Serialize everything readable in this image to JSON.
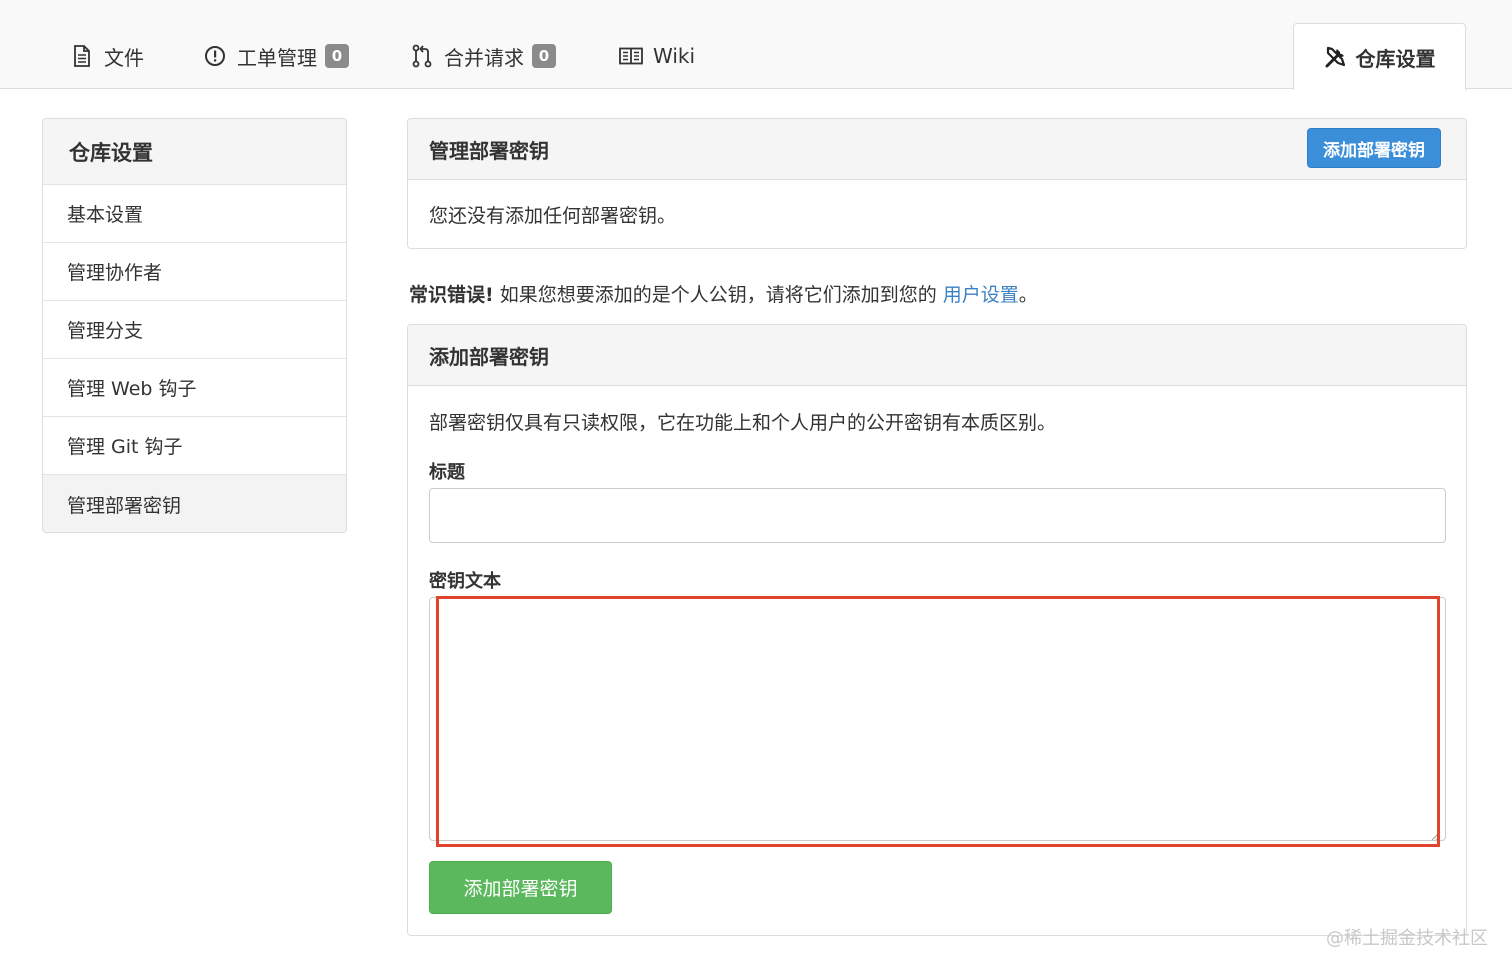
{
  "tabs": {
    "files": {
      "label": "文件",
      "icon": "file-icon"
    },
    "issues": {
      "label": "工单管理",
      "count": "0",
      "icon": "issue-icon"
    },
    "pulls": {
      "label": "合并请求",
      "count": "0",
      "icon": "git-pull-request-icon"
    },
    "wiki": {
      "label": "Wiki",
      "icon": "book-icon"
    },
    "settings": {
      "label": "仓库设置",
      "icon": "tools-icon"
    }
  },
  "sidebar": {
    "title": "仓库设置",
    "items": [
      {
        "label": "基本设置"
      },
      {
        "label": "管理协作者"
      },
      {
        "label": "管理分支"
      },
      {
        "label": "管理 Web 钩子"
      },
      {
        "label": "管理 Git 钩子"
      },
      {
        "label": "管理部署密钥",
        "active": true
      }
    ]
  },
  "manage_panel": {
    "title": "管理部署密钥",
    "add_button": "添加部署密钥",
    "empty_text": "您还没有添加任何部署密钥。"
  },
  "tip": {
    "strong": "常识错误!",
    "text": "如果您想要添加的是个人公钥，请将它们添加到您的",
    "link": "用户设置",
    "suffix": "。"
  },
  "add_panel": {
    "title": "添加部署密钥",
    "description": "部署密钥仅具有只读权限，它在功能上和个人用户的公开密钥有本质区别。",
    "title_label": "标题",
    "title_value": "",
    "content_label": "密钥文本",
    "content_value": "",
    "submit": "添加部署密钥"
  },
  "watermark": "@稀土掘金技术社区",
  "colors": {
    "primary": "#3b8ed8",
    "success": "#5cb85c",
    "link": "#3b82c4",
    "highlight": "#e0442f"
  }
}
